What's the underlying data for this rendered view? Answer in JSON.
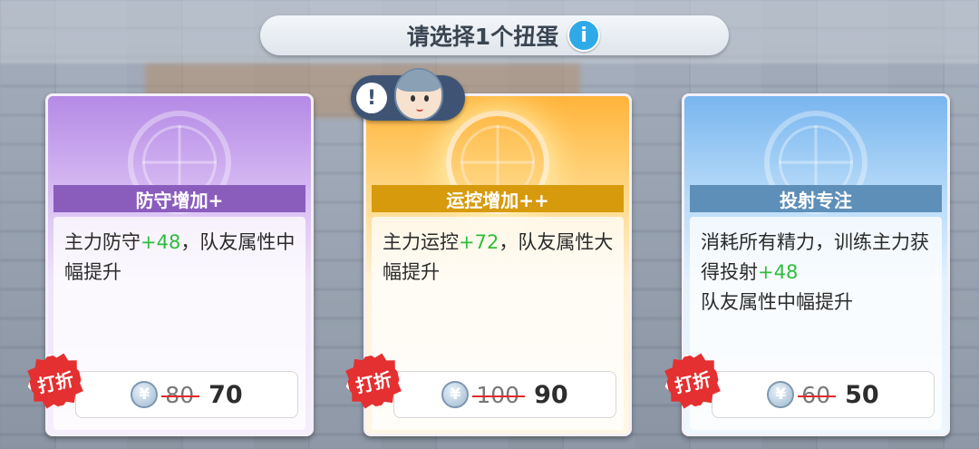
{
  "header": {
    "title": "请选择1个扭蛋",
    "info_icon": "i"
  },
  "hint": {
    "alert_icon": "!"
  },
  "cards": [
    {
      "title": "防守增加+",
      "desc_prefix": "主力防守",
      "desc_bonus": "+48",
      "desc_suffix": "，队友属性中幅提升",
      "old_price": "80",
      "new_price": "70",
      "badge": "打折",
      "coin_symbol": "¥",
      "theme": "#8a5dbd"
    },
    {
      "title": "运控增加++",
      "desc_prefix": "主力运控",
      "desc_bonus": "+72",
      "desc_suffix": "，队友属性大幅提升",
      "old_price": "100",
      "new_price": "90",
      "badge": "打折",
      "coin_symbol": "¥",
      "theme": "#d79a0c"
    },
    {
      "title": "投射专注",
      "desc_prefix": "消耗所有精力，训练主力获得投射",
      "desc_bonus": "+48",
      "desc_suffix": "队友属性中幅提升",
      "old_price": "60",
      "new_price": "50",
      "badge": "打折",
      "coin_symbol": "¥",
      "theme": "#5e8fb8"
    }
  ],
  "colors": {
    "bonus_green": "#2ebd3c",
    "sale_red": "#e43030",
    "info_blue": "#2fa9e8"
  }
}
